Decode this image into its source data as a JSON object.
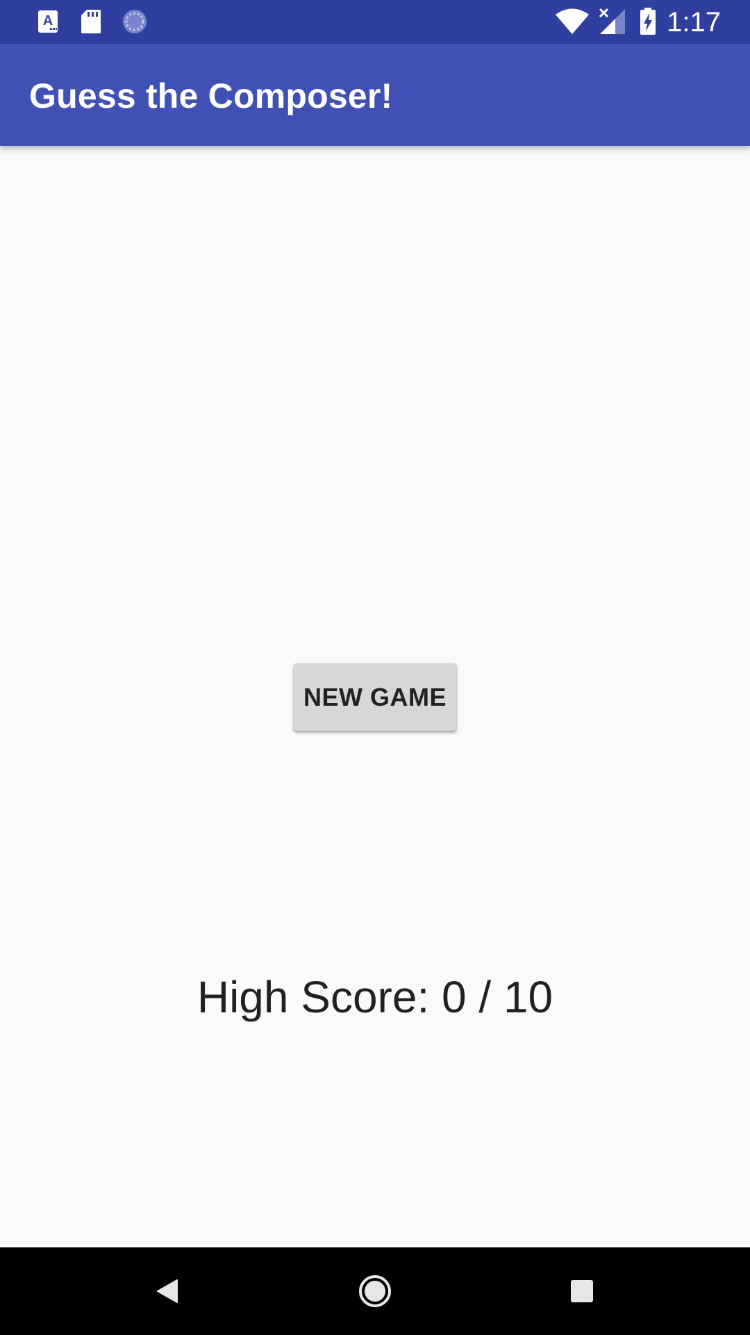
{
  "status_bar": {
    "time": "1:17",
    "icons": [
      "notification-a-icon",
      "sd-card-icon",
      "loading-icon",
      "wifi-icon",
      "signal-icon",
      "battery-charging-icon"
    ],
    "background": "#303f9f"
  },
  "app_bar": {
    "title": "Guess the Composer!",
    "background": "#3f51b5"
  },
  "main": {
    "new_game_label": "NEW GAME",
    "high_score_text": "High Score: 0 / 10"
  },
  "nav_bar": {
    "icons": [
      "back-icon",
      "home-icon",
      "recents-icon"
    ]
  }
}
